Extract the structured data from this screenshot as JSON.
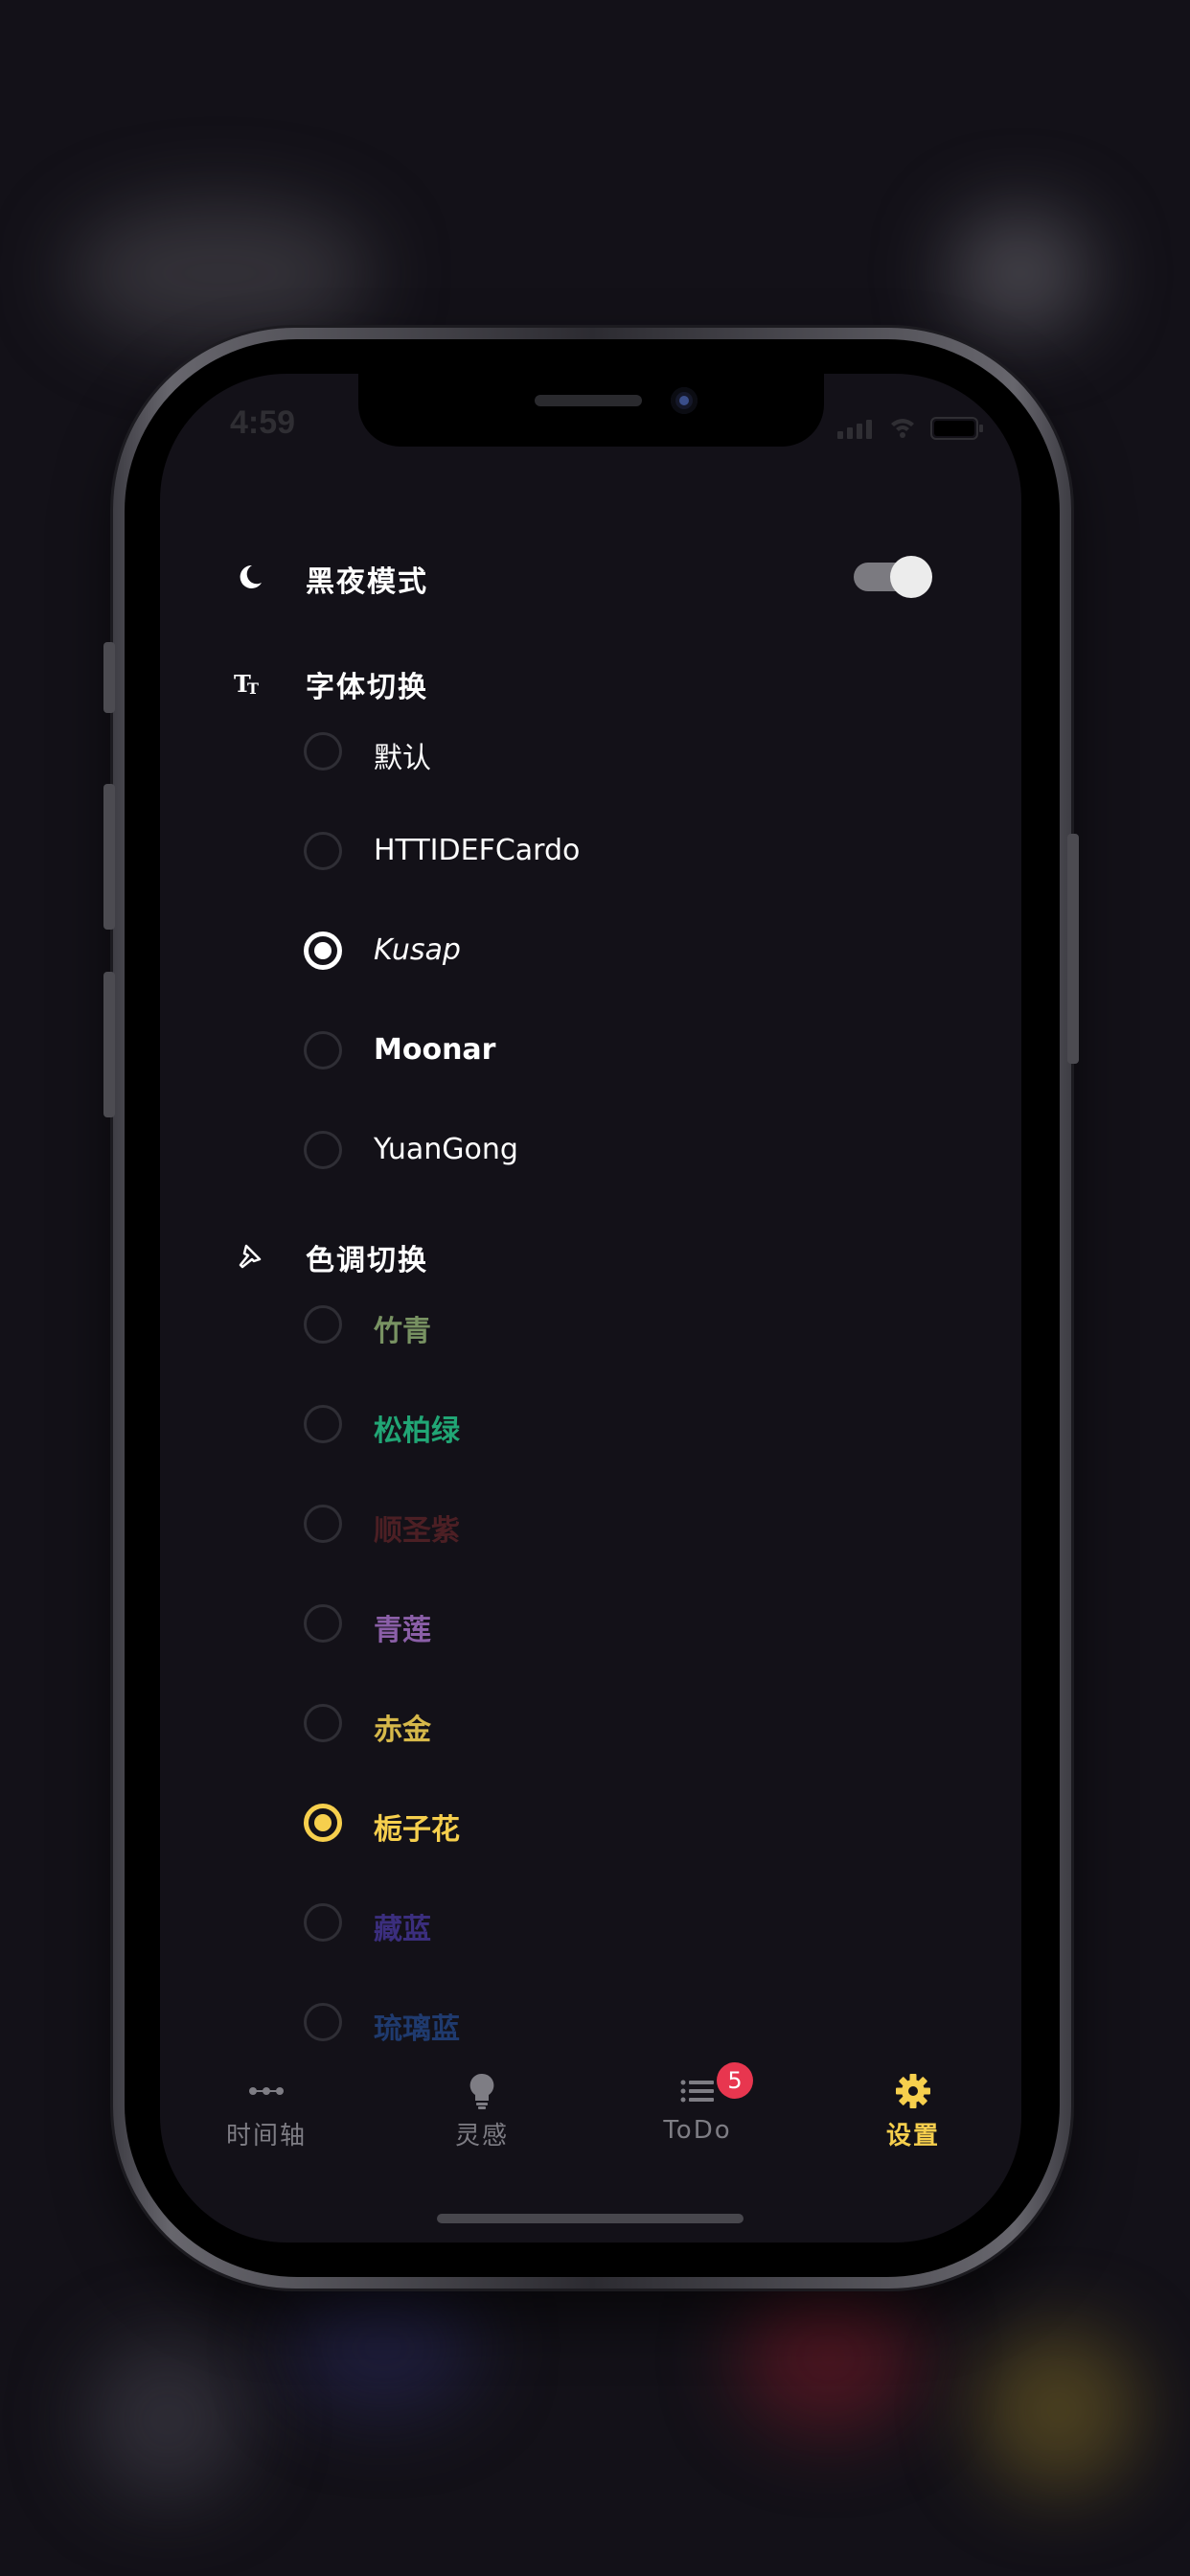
{
  "status_bar": {
    "time": "4:59"
  },
  "dark_mode": {
    "label": "黑夜模式",
    "enabled": true
  },
  "font_section": {
    "label": "字体切换",
    "options": [
      {
        "label": "默认",
        "selected": false
      },
      {
        "label": "HTTIDEFCardo",
        "selected": false
      },
      {
        "label": "Kusap",
        "selected": true
      },
      {
        "label": "Moonar",
        "selected": false
      },
      {
        "label": "YuanGong",
        "selected": false
      }
    ]
  },
  "color_section": {
    "label": "色调切换",
    "options": [
      {
        "label": "竹青",
        "color": "#789262",
        "selected": false
      },
      {
        "label": "松柏绿",
        "color": "#21a675",
        "selected": false
      },
      {
        "label": "顺圣紫",
        "color": "#4c1f24",
        "selected": false
      },
      {
        "label": "青莲",
        "color": "#8b5fa8",
        "selected": false
      },
      {
        "label": "赤金",
        "color": "#d6b84a",
        "selected": false
      },
      {
        "label": "栀子花",
        "color": "#f6cf4d",
        "selected": true
      },
      {
        "label": "藏蓝",
        "color": "#3b2e7e",
        "selected": false
      },
      {
        "label": "琉璃蓝",
        "color": "#1f3a6e",
        "selected": false
      }
    ]
  },
  "tab_bar": {
    "items": [
      {
        "label": "时间轴",
        "icon": "timeline-icon",
        "active": false
      },
      {
        "label": "灵感",
        "icon": "lightbulb-icon",
        "active": false
      },
      {
        "label": "ToDo",
        "icon": "list-icon",
        "active": false,
        "badge": "5"
      },
      {
        "label": "设置",
        "icon": "gear-icon",
        "active": true
      }
    ]
  },
  "colors": {
    "accent": "#f6cf4d",
    "background": "#131118",
    "badge": "#e8364f",
    "inactive_tab": "#7e7d84"
  }
}
